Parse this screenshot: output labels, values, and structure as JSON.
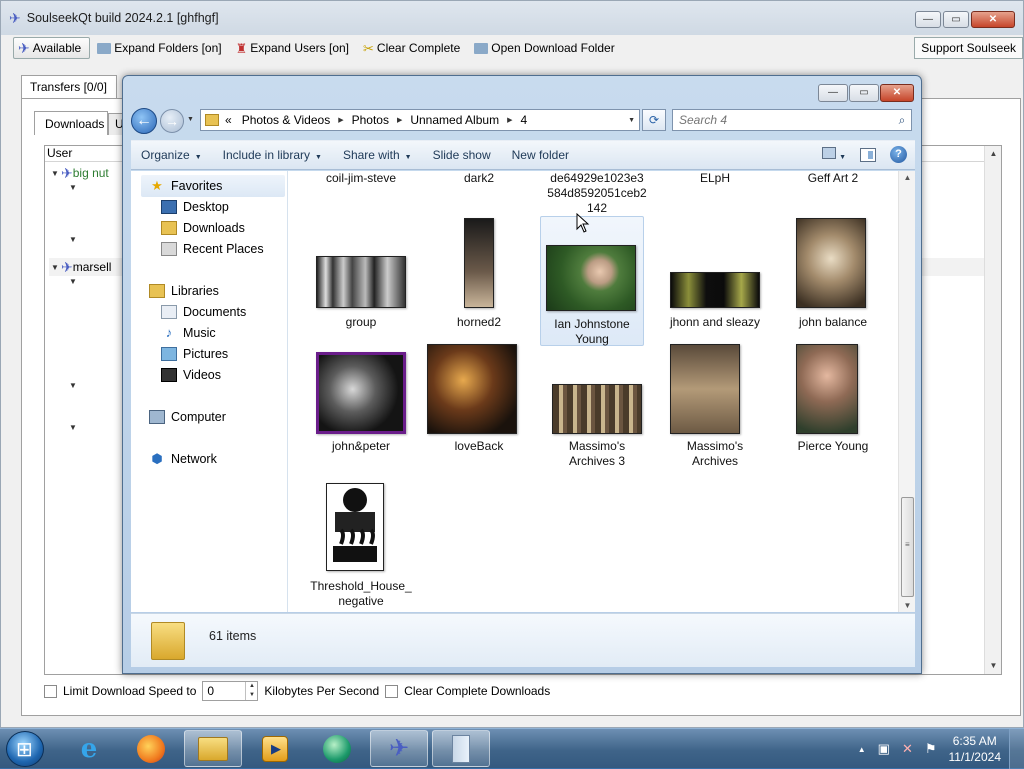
{
  "soulseek": {
    "title": "SoulseekQt build 2024.2.1 [ghfhgf]",
    "toolbar": {
      "available": "Available",
      "expand_folders": "Expand Folders [on]",
      "expand_users": "Expand Users [on]",
      "clear_complete": "Clear Complete",
      "open_download_folder": "Open Download Folder",
      "support": "Support Soulseek"
    },
    "tab_transfers": "Transfers [0/0]",
    "tab_downloads": "Downloads",
    "tab_uploads_stub": "U",
    "list_header_user": "User",
    "users": [
      "big nut",
      "marsell"
    ],
    "bottom": {
      "limit_label": "Limit Download Speed to",
      "limit_value": "0",
      "unit_label": "Kilobytes Per Second",
      "clear_label": "Clear Complete Downloads"
    }
  },
  "explorer": {
    "breadcrumb": [
      "Photos & Videos",
      "Photos",
      "Unnamed Album",
      "4"
    ],
    "breadcrumb_prefix": "«",
    "search_placeholder": "Search 4",
    "commands": {
      "organize": "Organize",
      "include_in_library": "Include in library",
      "share_with": "Share with",
      "slide_show": "Slide show",
      "new_folder": "New folder"
    },
    "nav": {
      "favorites": "Favorites",
      "desktop": "Desktop",
      "downloads": "Downloads",
      "recent_places": "Recent Places",
      "libraries": "Libraries",
      "documents": "Documents",
      "music": "Music",
      "pictures": "Pictures",
      "videos": "Videos",
      "computer": "Computer",
      "network": "Network"
    },
    "files_top_row": [
      "coil-jim-steve",
      "dark2",
      "de64929e1023e3584d8592051ceb2142",
      "ELpH",
      "Geff Art 2"
    ],
    "files_row2": [
      "group",
      "horned2",
      "Ian Johnstone Young",
      "jhonn and sleazy",
      "john balance"
    ],
    "files_row3": [
      "john&peter",
      "loveBack",
      "Massimo's Archives 3",
      "Massimo's Archives",
      "Pierce Young"
    ],
    "files_row4": [
      "Threshold_House_negative"
    ],
    "selected_file": "Ian Johnstone Young",
    "item_count": "61 items"
  },
  "taskbar": {
    "time": "6:35 AM",
    "date": "11/1/2024"
  }
}
